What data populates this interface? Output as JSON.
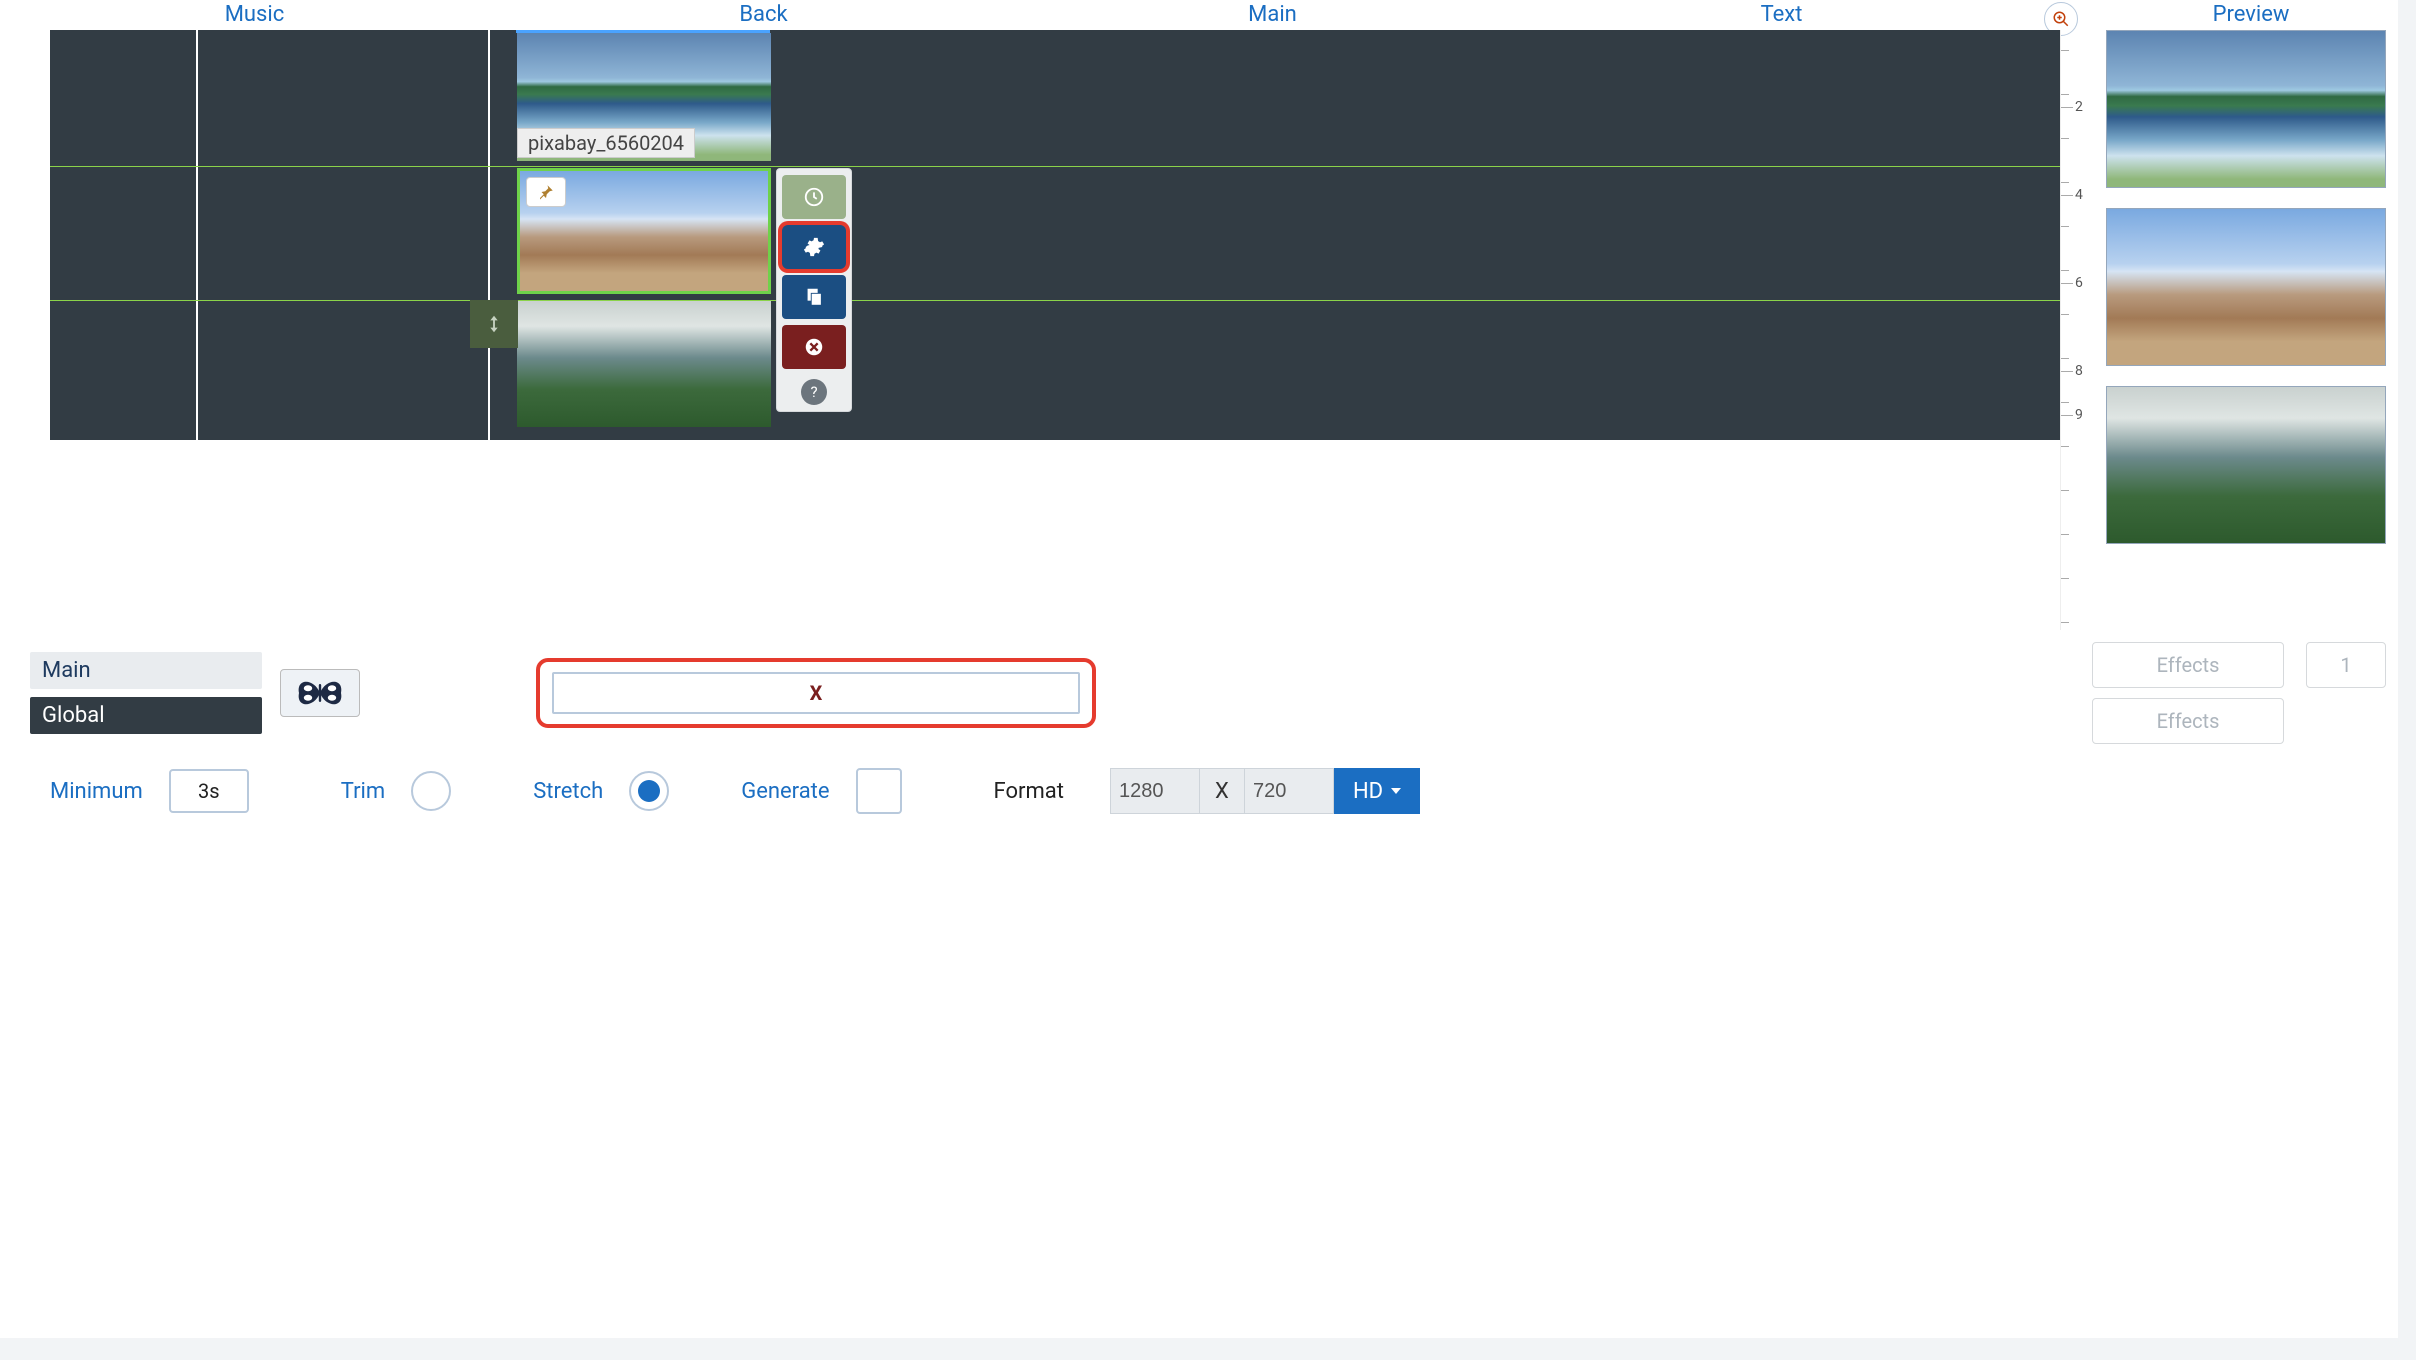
{
  "tabs": {
    "music": "Music",
    "back": "Back",
    "main": "Main",
    "text": "Text",
    "preview": "Preview"
  },
  "clip_label": "pixabay_6560204",
  "ruler": {
    "marks": [
      2,
      4,
      6,
      8,
      9
    ]
  },
  "actions": {
    "time": "clock-icon",
    "gear": "gear-icon",
    "dup": "duplicate-icon",
    "del": "close-circle-icon",
    "help": "?"
  },
  "layers": {
    "main": "Main",
    "global": "Global"
  },
  "x_button": "X",
  "effects_label": "Effects",
  "effects_count": "1",
  "bottom": {
    "minimum": "Minimum",
    "min_value": "3s",
    "trim": "Trim",
    "stretch": "Stretch",
    "generate": "Generate",
    "format": "Format",
    "width": "1280",
    "x": "X",
    "height": "720",
    "hd": "HD"
  }
}
